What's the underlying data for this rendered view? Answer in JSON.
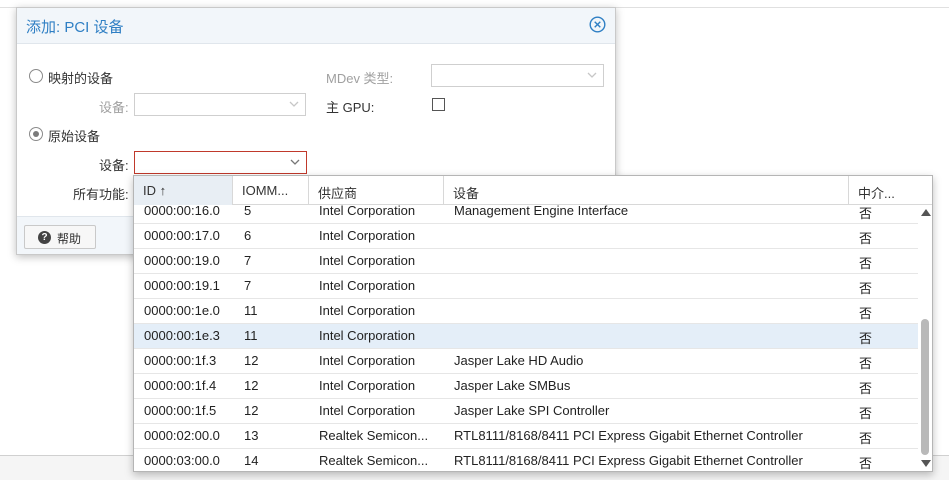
{
  "dialog": {
    "title": "添加: PCI 设备",
    "radio_mapped_label": "映射的设备",
    "mapped_device_label": "设备:",
    "radio_raw_label": "原始设备",
    "raw_device_label": "设备:",
    "all_functions_label": "所有功能:",
    "mdev_type_label": "MDev 类型:",
    "primary_gpu_label": "主 GPU:",
    "help_label": "帮助"
  },
  "grid": {
    "columns": [
      "ID ↑",
      "IOMM...",
      "供应商",
      "设备",
      "中介..."
    ],
    "rows": [
      {
        "id": "0000:00:16.0",
        "iommu": "5",
        "vendor": "Intel Corporation",
        "device": "Management Engine Interface",
        "mediated": "否"
      },
      {
        "id": "0000:00:17.0",
        "iommu": "6",
        "vendor": "Intel Corporation",
        "device": "",
        "mediated": "否"
      },
      {
        "id": "0000:00:19.0",
        "iommu": "7",
        "vendor": "Intel Corporation",
        "device": "",
        "mediated": "否"
      },
      {
        "id": "0000:00:19.1",
        "iommu": "7",
        "vendor": "Intel Corporation",
        "device": "",
        "mediated": "否"
      },
      {
        "id": "0000:00:1e.0",
        "iommu": "11",
        "vendor": "Intel Corporation",
        "device": "",
        "mediated": "否"
      },
      {
        "id": "0000:00:1e.3",
        "iommu": "11",
        "vendor": "Intel Corporation",
        "device": "",
        "mediated": "否"
      },
      {
        "id": "0000:00:1f.3",
        "iommu": "12",
        "vendor": "Intel Corporation",
        "device": "Jasper Lake HD Audio",
        "mediated": "否"
      },
      {
        "id": "0000:00:1f.4",
        "iommu": "12",
        "vendor": "Intel Corporation",
        "device": "Jasper Lake SMBus",
        "mediated": "否"
      },
      {
        "id": "0000:00:1f.5",
        "iommu": "12",
        "vendor": "Intel Corporation",
        "device": "Jasper Lake SPI Controller",
        "mediated": "否"
      },
      {
        "id": "0000:02:00.0",
        "iommu": "13",
        "vendor": "Realtek Semicon...",
        "device": "RTL8111/8168/8411 PCI Express Gigabit Ethernet Controller",
        "mediated": "否"
      },
      {
        "id": "0000:03:00.0",
        "iommu": "14",
        "vendor": "Realtek Semicon...",
        "device": "RTL8111/8168/8411 PCI Express Gigabit Ethernet Controller",
        "mediated": "否"
      }
    ],
    "selected_row": 5
  },
  "colors": {
    "accent": "#2f7fc4",
    "invalid_border": "#c0392b",
    "selected_row": "#e4eef8"
  },
  "icons": {
    "close": "close-circle-icon",
    "help": "question-circle-icon",
    "dropdown": "chevron-down-icon",
    "sort": "sort-ascending-icon"
  }
}
